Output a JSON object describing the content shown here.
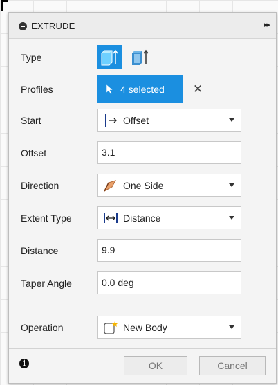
{
  "panel": {
    "title": "EXTRUDE",
    "expand_glyph": "▸▸"
  },
  "rows": {
    "type_label": "Type",
    "profiles_label": "Profiles",
    "profiles_value": "4 selected",
    "clear_glyph": "✕",
    "start_label": "Start",
    "start_value": "Offset",
    "offset_label": "Offset",
    "offset_value": "3.1",
    "direction_label": "Direction",
    "direction_value": "One Side",
    "extent_label": "Extent Type",
    "extent_value": "Distance",
    "distance_label": "Distance",
    "distance_value": "9.9",
    "taper_label": "Taper Angle",
    "taper_value": "0.0 deg",
    "operation_label": "Operation",
    "operation_value": "New Body"
  },
  "footer": {
    "info_glyph": "i",
    "ok_label": "OK",
    "cancel_label": "Cancel"
  },
  "colors": {
    "accent": "#1b8fe0",
    "panel_bg": "#f4f4f4"
  }
}
